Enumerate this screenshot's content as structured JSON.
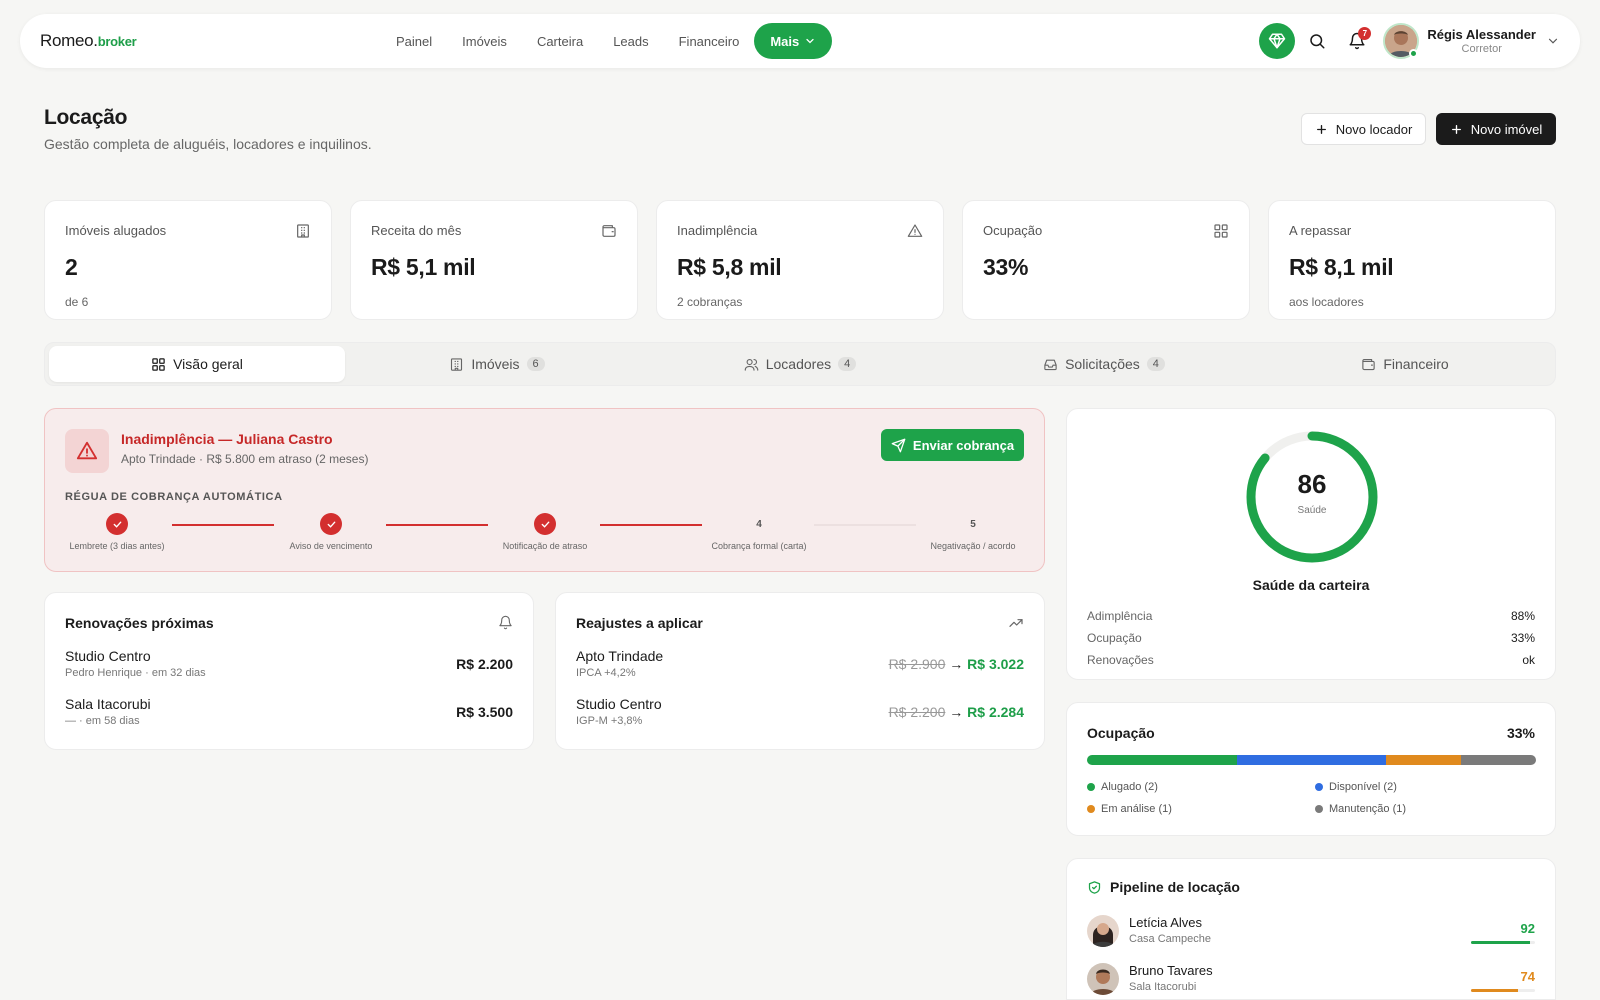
{
  "nav": {
    "logo_main": "Romeo.",
    "logo_accent": "broker",
    "items": [
      "Painel",
      "Imóveis",
      "Carteira",
      "Leads",
      "Financeiro"
    ],
    "more_label": "Mais",
    "notif_count": "7",
    "user_name": "Régis Alessander",
    "user_role": "Corretor",
    "accent": "#1ea34a"
  },
  "header": {
    "title": "Locação",
    "subtitle": "Gestão completa de aluguéis, locadores e inquilinos.",
    "btn_new_landlord": "Novo locador",
    "btn_new_property": "Novo imóvel"
  },
  "stats": [
    {
      "label": "Imóveis alugados",
      "value": "2",
      "sub": "de 6",
      "icon": "building-icon"
    },
    {
      "label": "Receita do mês",
      "value": "R$ 5,1 mil",
      "sub": "",
      "icon": "wallet-icon"
    },
    {
      "label": "Inadimplência",
      "value": "R$ 5,8 mil",
      "sub": "2 cobranças",
      "icon": "alert-triangle-icon"
    },
    {
      "label": "Ocupação",
      "value": "33%",
      "sub": "",
      "icon": "grid-icon"
    },
    {
      "label": "A repassar",
      "value": "R$ 8,1 mil",
      "sub": "aos locadores",
      "icon": null
    }
  ],
  "tabs": [
    {
      "label": "Visão geral",
      "count": ""
    },
    {
      "label": "Imóveis",
      "count": "6"
    },
    {
      "label": "Locadores",
      "count": "4"
    },
    {
      "label": "Solicitações",
      "count": "4"
    },
    {
      "label": "Financeiro",
      "count": ""
    }
  ],
  "alert": {
    "title": "Inadimplência — Juliana Castro",
    "subtitle": "Apto Trindade · R$ 5.800 em atraso (2 meses)",
    "button": "Enviar cobrança",
    "rule_title": "RÉGUA DE COBRANÇA AUTOMÁTICA",
    "steps": [
      {
        "num": "1",
        "label": "Lembrete (3 dias antes)",
        "done": true
      },
      {
        "num": "2",
        "label": "Aviso de vencimento",
        "done": true
      },
      {
        "num": "3",
        "label": "Notificação de atraso",
        "done": true
      },
      {
        "num": "4",
        "label": "Cobrança formal (carta)",
        "done": false
      },
      {
        "num": "5",
        "label": "Negativação / acordo",
        "done": false
      }
    ],
    "color": "#d32f2f"
  },
  "renewals": {
    "title": "Renovações próximas",
    "rows": [
      {
        "name": "Studio Centro",
        "sub": "Pedro Henrique · em 32 dias",
        "value": "R$ 2.200"
      },
      {
        "name": "Sala Itacorubi",
        "sub": "— · em 58 dias",
        "value": "R$ 3.500"
      }
    ]
  },
  "adjustments": {
    "title": "Reajustes a aplicar",
    "rows": [
      {
        "name": "Apto Trindade",
        "sub": "IPCA +4,2%",
        "old": "R$ 2.900",
        "arrow": "→",
        "new": "R$ 3.022"
      },
      {
        "name": "Studio Centro",
        "sub": "IGP-M +3,8%",
        "old": "R$ 2.200",
        "arrow": "→",
        "new": "R$ 2.284"
      }
    ]
  },
  "health": {
    "score": "86",
    "score_value": 86,
    "score_label": "Saúde",
    "title": "Saúde da carteira",
    "rows": [
      {
        "label": "Adimplência",
        "value": "88%"
      },
      {
        "label": "Ocupação",
        "value": "33%"
      },
      {
        "label": "Renovações",
        "value": "ok"
      }
    ]
  },
  "occupancy": {
    "title": "Ocupação",
    "pct": "33%",
    "segments": [
      {
        "label": "Alugado (2)",
        "count": 2,
        "color": "#1ea34a"
      },
      {
        "label": "Disponível (2)",
        "count": 2,
        "color": "#2f6de1"
      },
      {
        "label": "Em análise (1)",
        "count": 1,
        "color": "#e08a1e"
      },
      {
        "label": "Manutenção (1)",
        "count": 1,
        "color": "#7a7a7a"
      }
    ]
  },
  "pipeline": {
    "title": "Pipeline de locação",
    "rows": [
      {
        "name": "Letícia Alves",
        "sub": "Casa Campeche",
        "score": "92",
        "score_value": 92,
        "color": "#1ea34a"
      },
      {
        "name": "Bruno Tavares",
        "sub": "Sala Itacorubi",
        "score": "74",
        "score_value": 74,
        "color": "#e08a1e"
      }
    ]
  }
}
